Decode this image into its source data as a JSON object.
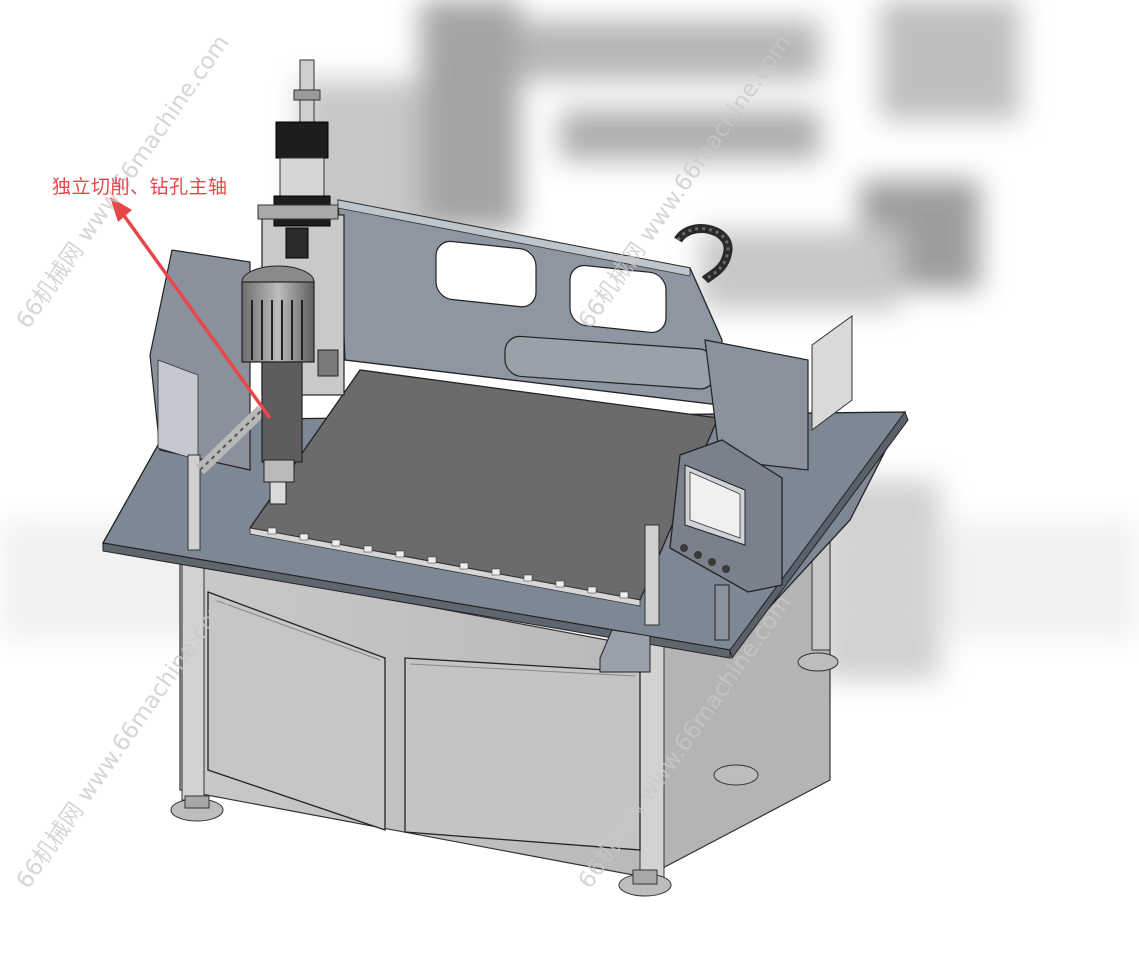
{
  "annotation": {
    "label": "独立切削、钻孔主轴",
    "color": "#e8474a"
  },
  "watermark": {
    "text": "66机械网 www.66machine.com",
    "color": "#c9c9c9"
  },
  "colors": {
    "table_top": "#7e8794",
    "steel_frame": "#8e96a2",
    "work_plate": "#6b6b6b",
    "cabinet": "#c2c2c2",
    "accent_red": "#e8474a"
  },
  "icons": {
    "spindle_motor": "motor-icon",
    "control_panel": "hmi-panel-icon",
    "cable_chain": "cable-chain-icon",
    "leveling_feet": "foot-icon"
  }
}
